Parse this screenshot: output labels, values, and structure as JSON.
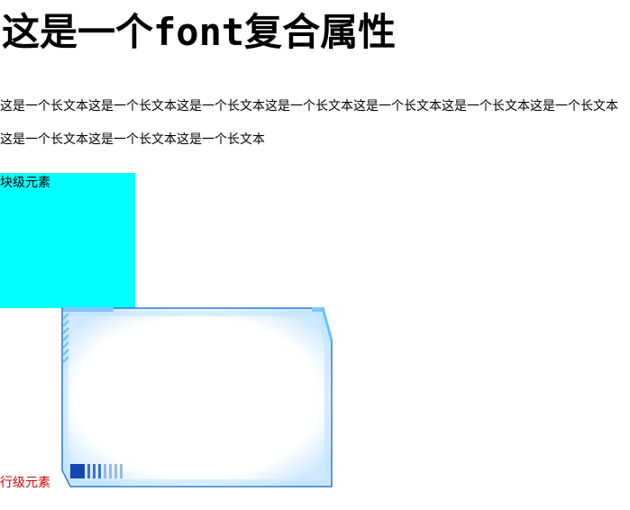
{
  "heading": "这是一个font复合属性",
  "paragraph": "这是一个长文本这是一个长文本这是一个长文本这是一个长文本这是一个长文本这是一个长文本这是一个长文本这是一个长文本这是一个长文本这是一个长文本",
  "block_element": {
    "label": "块级元素",
    "background": "#00ffff"
  },
  "inline_element": {
    "label": "行级元素",
    "color": "#dd0000",
    "image": "decorative-tech-frame"
  }
}
